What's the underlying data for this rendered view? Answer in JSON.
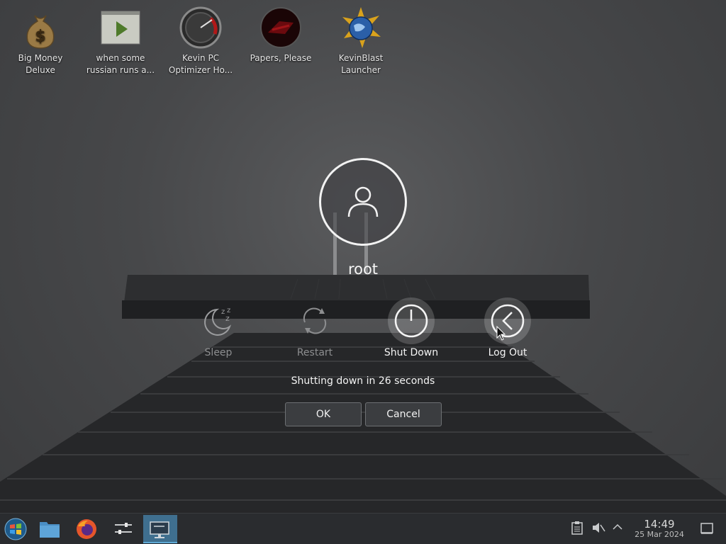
{
  "desktop": {
    "icons": [
      {
        "label": "Big Money Deluxe",
        "icon": "money-bag-icon"
      },
      {
        "label": "when some russian runs a...",
        "icon": "video-player-icon"
      },
      {
        "label": "Kevin PC Optimizer Ho...",
        "icon": "speedometer-icon"
      },
      {
        "label": "Papers, Please",
        "icon": "papers-please-icon"
      },
      {
        "label": "KevinBlast Launcher",
        "icon": "globe-star-icon"
      }
    ]
  },
  "dialog": {
    "username": "root",
    "actions": [
      {
        "label": "Sleep",
        "icon": "sleep-moon-icon",
        "state": "dim"
      },
      {
        "label": "Restart",
        "icon": "restart-icon",
        "state": "dim"
      },
      {
        "label": "Shut Down",
        "icon": "power-icon",
        "state": "highlighted"
      },
      {
        "label": "Log Out",
        "icon": "logout-arrow-icon",
        "state": "highlighted"
      }
    ],
    "countdown": "Shutting down in 26 seconds",
    "ok_label": "OK",
    "cancel_label": "Cancel"
  },
  "taskbar": {
    "items": [
      {
        "icon": "start-menu-icon"
      },
      {
        "icon": "file-manager-icon"
      },
      {
        "icon": "firefox-icon"
      },
      {
        "icon": "settings-sliders-icon"
      },
      {
        "icon": "display-icon",
        "active": true
      }
    ],
    "tray": {
      "clipboard_icon": "clipboard-icon",
      "volume_icon": "volume-muted-icon",
      "expand_icon": "chevron-up-icon",
      "time": "14:49",
      "date": "25 Mar 2024",
      "show_desktop_icon": "show-desktop-icon"
    }
  },
  "colors": {
    "accent": "#3f6f8f",
    "dialog_text": "#f4f4f4",
    "dim_text": "#8d8e90"
  }
}
